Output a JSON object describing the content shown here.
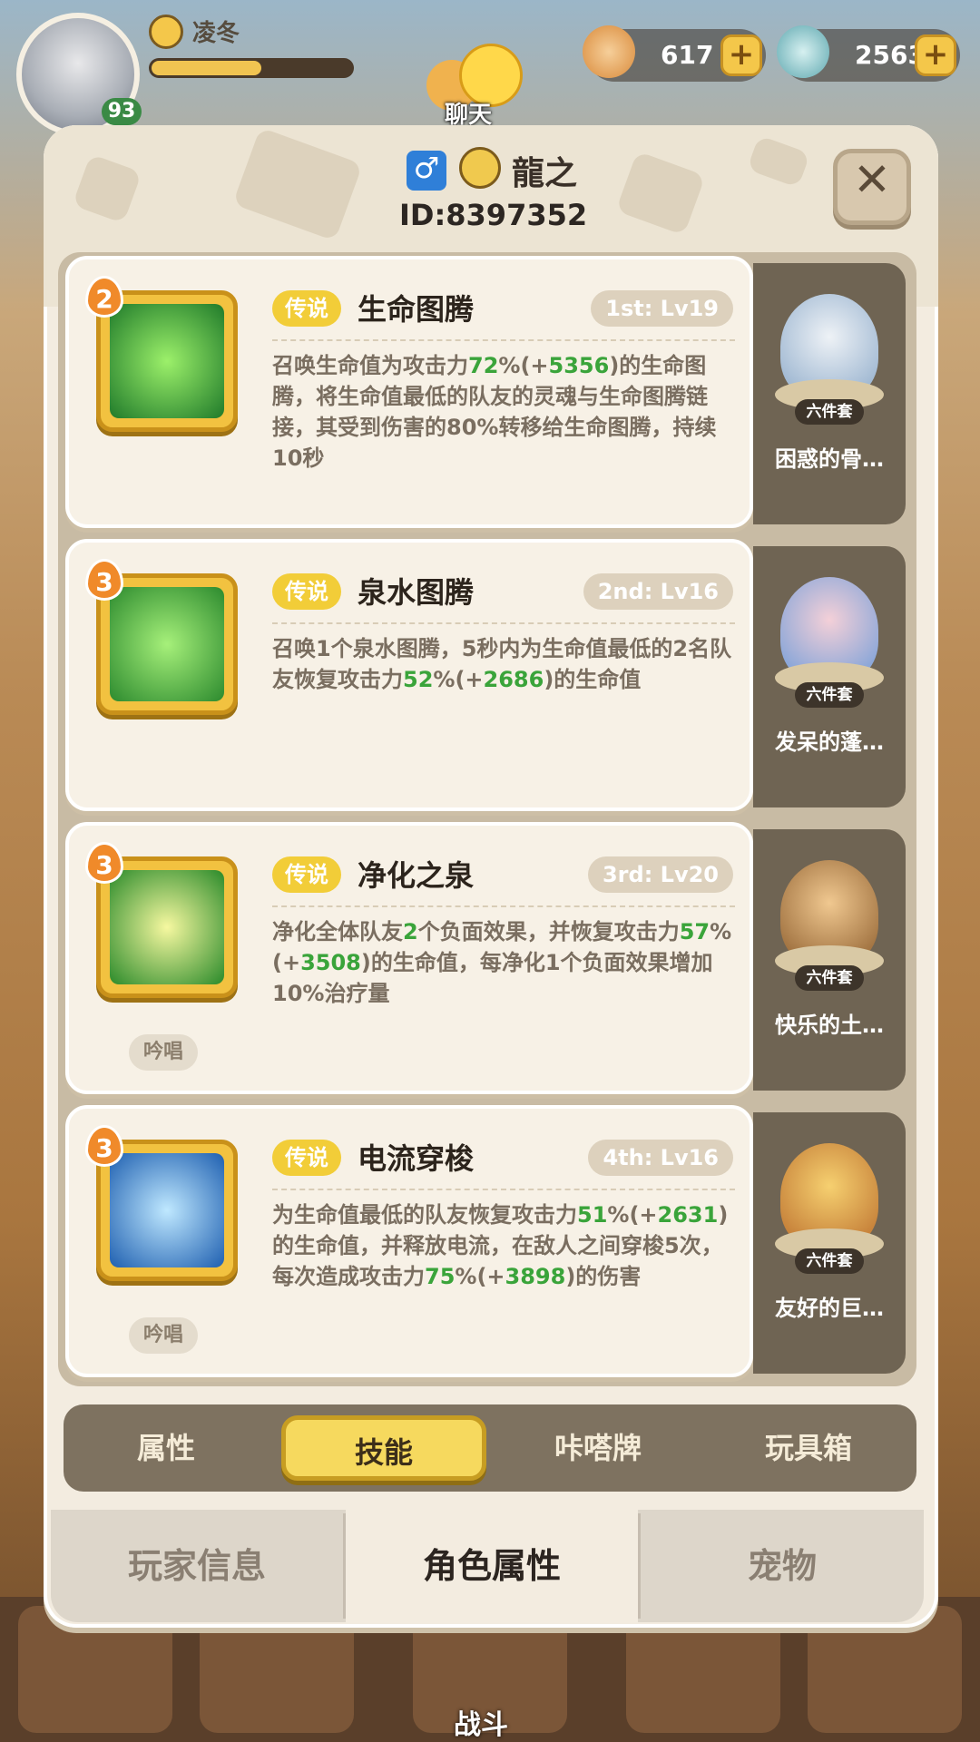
{
  "hud": {
    "player_name": "凌冬",
    "level": "93",
    "exp_fraction": 0.55,
    "currency1": "617",
    "currency2": "2563",
    "chat_label": "聊天"
  },
  "profile": {
    "name": "龍之",
    "id": "ID:8397352",
    "gender_icon": "male-icon"
  },
  "skills": [
    {
      "num": "2",
      "badge": "传说",
      "name": "生命图腾",
      "rank": "1st: Lv19",
      "desc_parts": [
        "召唤生命值为攻击力",
        "72",
        "%(+",
        "5356",
        ")的生命图腾，将生命值最低的队友的灵魂与生命图腾链接，其受到伤害的80%转移给生命图腾，持续10秒"
      ],
      "chant": "",
      "pet_name": "困惑的骨…",
      "pet_set": "六件套"
    },
    {
      "num": "3",
      "badge": "传说",
      "name": "泉水图腾",
      "rank": "2nd: Lv16",
      "desc_parts": [
        "召唤1个泉水图腾，5秒内为生命值最低的2名队友恢复攻击力",
        "52",
        "%(+",
        "2686",
        ")的生命值"
      ],
      "chant": "",
      "pet_name": "发呆的蓬…",
      "pet_set": "六件套"
    },
    {
      "num": "3",
      "badge": "传说",
      "name": "净化之泉",
      "rank": "3rd: Lv20",
      "desc_parts": [
        "净化全体队友",
        "2",
        "个负面效果，并恢复攻击力",
        "57",
        "%(+",
        "3508",
        ")的生命值，每净化1个负面效果增加10%治疗量"
      ],
      "chant": "吟唱",
      "pet_name": "快乐的土…",
      "pet_set": "六件套"
    },
    {
      "num": "3",
      "badge": "传说",
      "name": "电流穿梭",
      "rank": "4th: Lv16",
      "desc_parts": [
        "为生命值最低的队友恢复攻击力",
        "51",
        "%(+",
        "2631",
        ")的生命值，并释放电流，在敌人之间穿梭5次，每次造成攻击力",
        "75",
        "%(+",
        "3898",
        ")的伤害"
      ],
      "chant": "吟唱",
      "pet_name": "友好的巨…",
      "pet_set": "六件套"
    }
  ],
  "subtabs": [
    "属性",
    "技能",
    "咔嗒牌",
    "玩具箱"
  ],
  "subtab_active": 1,
  "maintabs": [
    "玩家信息",
    "角色属性",
    "宠物"
  ],
  "maintab_active": 1,
  "bottom_nav": {
    "battle_label": "战斗"
  },
  "colors": {
    "accent_yellow": "#f2cd38",
    "value_green": "#3aa43a",
    "panel": "#f3ece0"
  }
}
